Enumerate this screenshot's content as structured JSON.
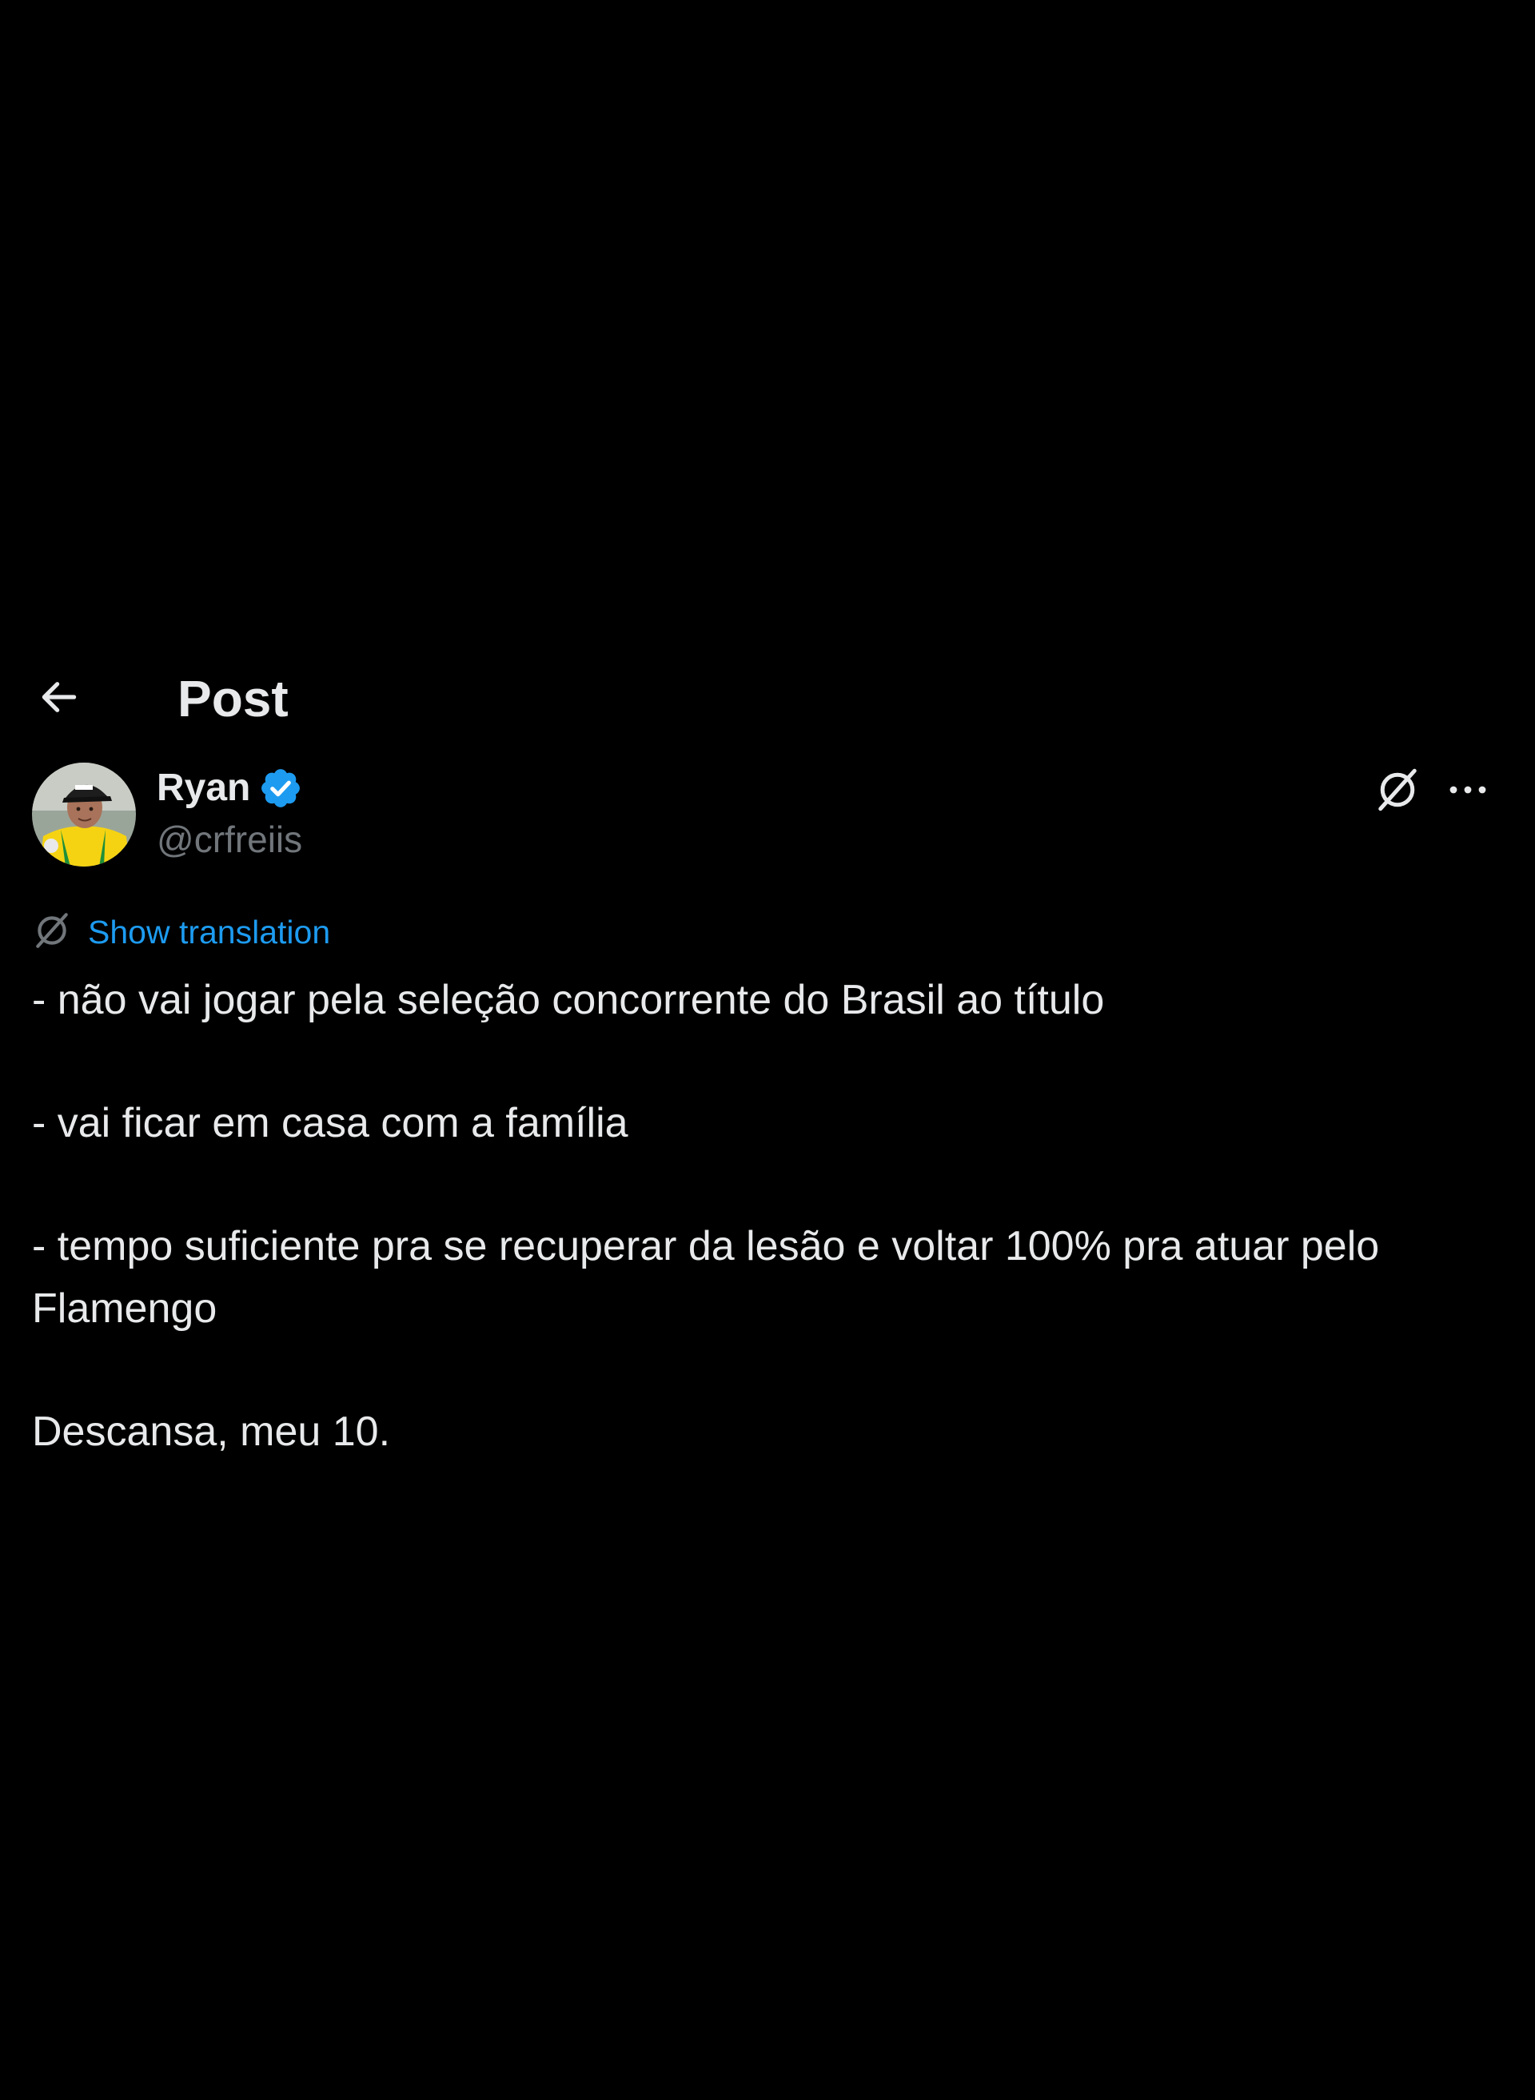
{
  "header": {
    "back_icon": "arrow-left-icon",
    "title": "Post"
  },
  "author": {
    "display_name": "Ryan",
    "verified_icon": "verified-badge-icon",
    "handle": "@crfreiis",
    "avatar_colors": {
      "shirt": "#f5d312",
      "accent": "#1f8f3a",
      "cap": "#1d1d1d",
      "skin": "#a8735a"
    }
  },
  "actions": {
    "grok_icon": "grok-icon",
    "more_icon": "more-icon"
  },
  "translation": {
    "icon": "grok-icon",
    "label": "Show translation"
  },
  "post": {
    "lines": [
      "- não vai jogar pela seleção concorrente do Brasil ao título",
      "- vai ficar em casa com a família",
      "- tempo suficiente pra se recuperar da lesão e voltar 100% pra atuar pelo Flamengo",
      "Descansa, meu 10."
    ]
  },
  "colors": {
    "background": "#000000",
    "text_primary": "#e7e9ea",
    "text_secondary": "#71767b",
    "link": "#1d9bf0",
    "verified": "#1d9bf0"
  }
}
